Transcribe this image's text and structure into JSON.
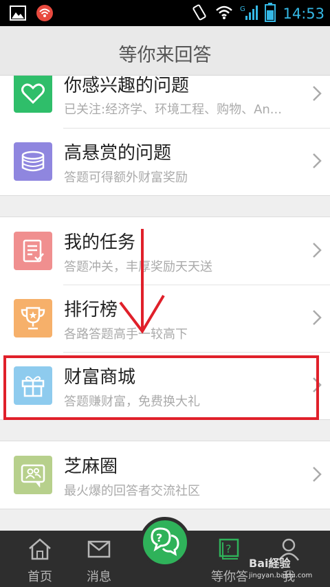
{
  "status_bar": {
    "time": "14:53",
    "network": "G"
  },
  "header": {
    "title": "等你来回答"
  },
  "groups": [
    [
      {
        "title": "你感兴趣的问题",
        "subtitle": "已关注:经济学、环境工程、购物、An...",
        "icon": "heart-icon",
        "color": "#2fbe6a"
      },
      {
        "title": "高悬赏的问题",
        "subtitle": "答题可得额外财富奖励",
        "icon": "coins-icon",
        "color": "#8f86df"
      }
    ],
    [
      {
        "title": "我的任务",
        "subtitle": "答题冲关，丰厚奖励天天送",
        "icon": "task-icon",
        "color": "#f08f8f"
      },
      {
        "title": "排行榜",
        "subtitle": "各路答题高手一较高下",
        "icon": "trophy-icon",
        "color": "#f6b06a"
      },
      {
        "title": "财富商城",
        "subtitle": "答题赚财富，免费换大礼",
        "icon": "gift-icon",
        "color": "#8ecbee"
      }
    ],
    [
      {
        "title": "芝麻圈",
        "subtitle": "最火爆的回答者交流社区",
        "icon": "community-icon",
        "color": "#b7d08c"
      }
    ]
  ],
  "tabs": [
    {
      "label": "首页",
      "icon": "home-icon"
    },
    {
      "label": "消息",
      "icon": "mail-icon"
    },
    {
      "label": "等你答",
      "icon": "answer-icon"
    },
    {
      "label": "我",
      "icon": "user-icon"
    }
  ],
  "watermark": {
    "text": "Bai経验",
    "sub": "jingyan.baidu.com"
  }
}
